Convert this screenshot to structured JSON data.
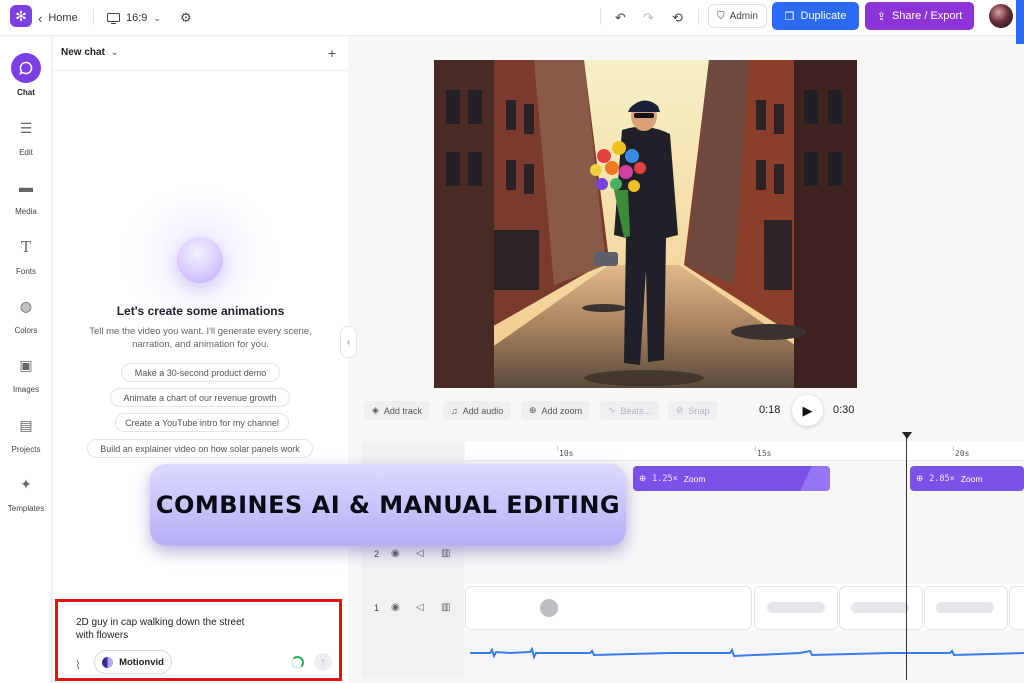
{
  "topbar": {
    "home_label": "Home",
    "aspect_label": "16:9",
    "admin_label": "Admin",
    "duplicate_label": "Duplicate",
    "share_label": "Share / Export"
  },
  "rail": {
    "items": [
      {
        "label": "Chat",
        "icon": "chat-icon"
      },
      {
        "label": "Edit",
        "icon": "sliders-icon"
      },
      {
        "label": "Media",
        "icon": "folder-icon"
      },
      {
        "label": "Fonts",
        "icon": "text-icon"
      },
      {
        "label": "Colors",
        "icon": "palette-icon"
      },
      {
        "label": "Images",
        "icon": "image-icon"
      },
      {
        "label": "Projects",
        "icon": "projects-icon"
      },
      {
        "label": "Templates",
        "icon": "sparkle-icon"
      }
    ]
  },
  "chat": {
    "header": "New chat",
    "title": "Let's create some animations",
    "subtitle": "Tell me the video you want. I'll generate every scene, narration, and animation for you.",
    "suggestions": [
      "Make a 30-second product demo",
      "Animate a chart of our revenue growth",
      "Create a YouTube intro for my channel",
      "Build an explainer video on how solar panels work"
    ],
    "input_value": "2D guy in cap walking down the street with flowers",
    "model_label": "Motionvid"
  },
  "player": {
    "add_track": "Add track",
    "add_audio": "Add audio",
    "add_zoom": "Add zoom",
    "beats": "Beats...",
    "snap": "Snap",
    "current_time": "0:18",
    "total_time": "0:30"
  },
  "timeline": {
    "ticks": [
      "10s",
      "15s",
      "20s"
    ],
    "zoom_clips": [
      {
        "factor": "1.25×",
        "label": "Zoom"
      },
      {
        "factor": "2.85×",
        "label": "Zoom"
      }
    ],
    "tracks": [
      "2",
      "1"
    ]
  },
  "banner": {
    "text": "COMBINES AI & MANUAL EDITING"
  },
  "colors": {
    "brand_purple": "#7b3fe4",
    "duplicate_blue": "#2b6af5",
    "share_purple": "#8d34d9",
    "zoom_clip": "#7a52e8",
    "highlight_red": "#e01414"
  }
}
